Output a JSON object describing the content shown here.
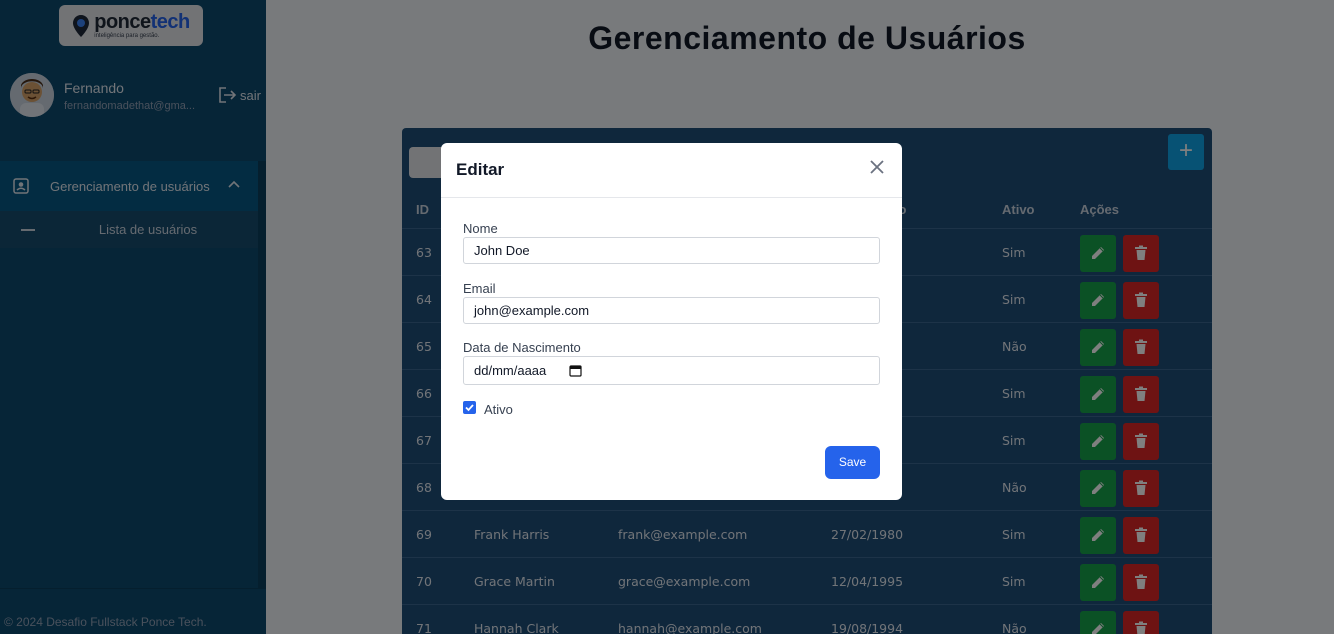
{
  "brand": {
    "name_a": "ponce",
    "name_b": "tech",
    "tagline": "inteligência para gestão."
  },
  "user": {
    "name": "Fernando",
    "email": "fernandomadethat@gma...",
    "logout_label": "sair"
  },
  "sidebar": {
    "group_label": "Gerenciamento de usuários",
    "items": [
      {
        "label": "Lista de usuários"
      }
    ]
  },
  "footer": {
    "text": "© 2024 Desafio Fullstack Ponce Tech."
  },
  "page": {
    "title": "Gerenciamento de Usuários"
  },
  "table": {
    "add_label": "+",
    "headers": {
      "id": "ID",
      "birth": "ento",
      "active": "Ativo",
      "actions": "Ações"
    },
    "rows": [
      {
        "id": "63",
        "name": "",
        "email": "",
        "birth": "",
        "active": "Sim"
      },
      {
        "id": "64",
        "name": "",
        "email": "",
        "birth": "",
        "active": "Sim"
      },
      {
        "id": "65",
        "name": "",
        "email": "",
        "birth": "",
        "active": "Não"
      },
      {
        "id": "66",
        "name": "",
        "email": "",
        "birth": "",
        "active": "Sim"
      },
      {
        "id": "67",
        "name": "",
        "email": "",
        "birth": "",
        "active": "Sim"
      },
      {
        "id": "68",
        "name": "",
        "email": "",
        "birth": "",
        "active": "Não"
      },
      {
        "id": "69",
        "name": "Frank Harris",
        "email": "frank@example.com",
        "birth": "27/02/1980",
        "active": "Sim"
      },
      {
        "id": "70",
        "name": "Grace Martin",
        "email": "grace@example.com",
        "birth": "12/04/1995",
        "active": "Sim"
      },
      {
        "id": "71",
        "name": "Hannah Clark",
        "email": "hannah@example.com",
        "birth": "19/08/1994",
        "active": "Não"
      }
    ]
  },
  "modal": {
    "title": "Editar",
    "name_label": "Nome",
    "name_value": "John Doe",
    "email_label": "Email",
    "email_value": "john@example.com",
    "birth_label": "Data de Nascimento",
    "birth_value": "dd/mm/aaaa",
    "active_label": "Ativo",
    "active_checked": true,
    "save_label": "Save"
  },
  "colors": {
    "sidebar": "#0c4a6e",
    "primary": "#2563eb",
    "edit": "#16a34a",
    "delete": "#dc2626"
  }
}
